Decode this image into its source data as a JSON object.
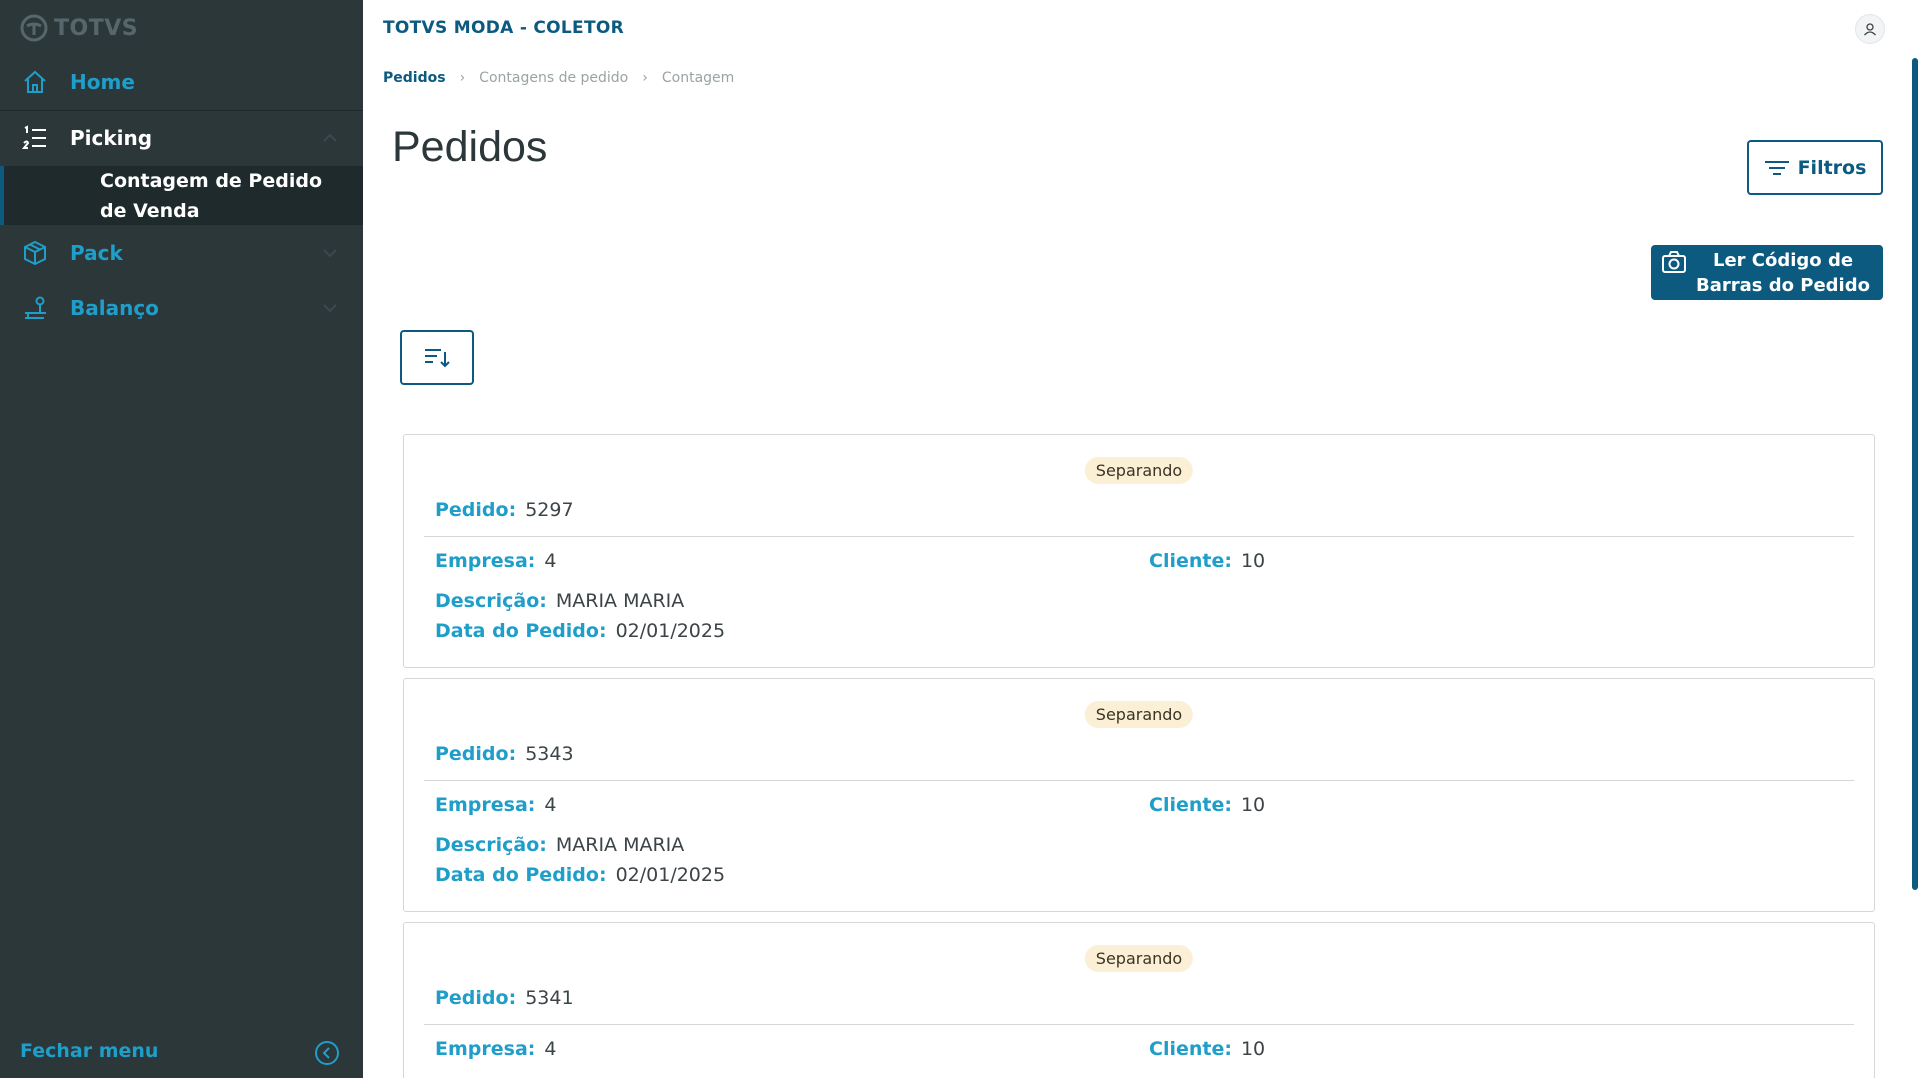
{
  "sidebar": {
    "logo_text": "TOTVS",
    "items": [
      {
        "label": "Home",
        "icon": "home-icon"
      },
      {
        "label": "Picking",
        "icon": "list-numbered-icon"
      },
      {
        "label": "Pack",
        "icon": "box-icon"
      },
      {
        "label": "Balanço",
        "icon": "scale-icon"
      }
    ],
    "submenu": {
      "label": "Contagem de Pedido de Venda"
    },
    "close_label": "Fechar menu"
  },
  "header": {
    "app_title": "TOTVS MODA - COLETOR"
  },
  "breadcrumb": [
    "Pedidos",
    "Contagens de pedido",
    "Contagem"
  ],
  "page": {
    "title": "Pedidos",
    "filters_label": "Filtros",
    "barcode_label": "Ler Código de Barras do Pedido"
  },
  "labels": {
    "pedido": "Pedido:",
    "empresa": "Empresa:",
    "cliente": "Cliente:",
    "descricao": "Descrição:",
    "data": "Data do Pedido:"
  },
  "orders": [
    {
      "status": "Separando",
      "pedido": "5297",
      "empresa": "4",
      "cliente": "10",
      "descricao": "MARIA MARIA",
      "data": "02/01/2025"
    },
    {
      "status": "Separando",
      "pedido": "5343",
      "empresa": "4",
      "cliente": "10",
      "descricao": "MARIA MARIA",
      "data": "02/01/2025"
    },
    {
      "status": "Separando",
      "pedido": "5341",
      "empresa": "4",
      "cliente": "10"
    }
  ],
  "colors": {
    "sidebar_bg": "#2c3739",
    "primary": "#0c5a80",
    "accent": "#1f9ec9",
    "badge_bg": "#fbf0d6"
  }
}
